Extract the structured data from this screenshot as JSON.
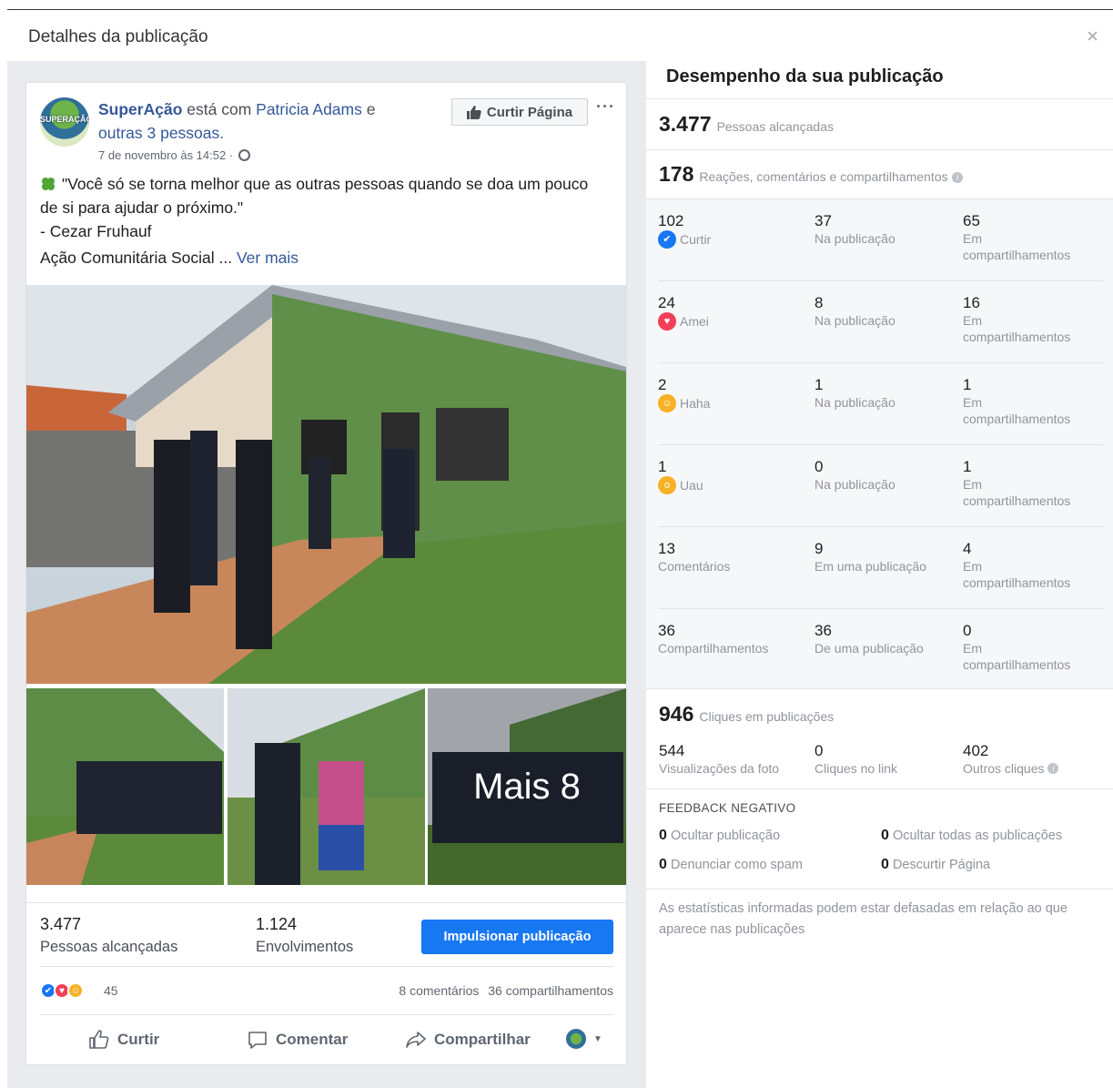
{
  "modal": {
    "title": "Detalhes da publicação",
    "close": "×"
  },
  "post": {
    "page_name": "SuperAção",
    "with_text": "está com",
    "tagged_person": "Patricia Adams",
    "and_text": "e",
    "others": "outras 3 pessoas.",
    "avatar_text": "SUPERAÇÃO",
    "timestamp": "7 de novembro às 14:52 ·",
    "like_page_label": "Curtir Página",
    "text_line1": "\"Você só se torna melhor que as outras pessoas quando se doa um pouco de si para ajudar o próximo.\"",
    "text_line2": "- Cezar Fruhauf",
    "text_more": "Ação Comunitária Social ...",
    "see_more": "Ver mais",
    "more_photos": "Mais 8",
    "reached_num": "3.477",
    "reached_label": "Pessoas alcançadas",
    "engagement_num": "1.124",
    "engagement_label": "Envolvimentos",
    "boost_label": "Impulsionar publicação",
    "reaction_count": "45",
    "comments_text": "8 comentários",
    "shares_text": "36 compartilhamentos",
    "action_like": "Curtir",
    "action_comment": "Comentar",
    "action_share": "Compartilhar"
  },
  "performance": {
    "title": "Desempenho da sua publicação",
    "reached_num": "3.477",
    "reached_label": "Pessoas alcançadas",
    "engagement_num": "178",
    "engagement_label": "Reações, comentários e compartilhamentos",
    "rows": [
      {
        "num": "102",
        "label": "Curtir",
        "icon": "like-icon",
        "mid_num": "37",
        "mid_label": "Na publicação",
        "right_num": "65",
        "right_label": "Em compartilhamentos"
      },
      {
        "num": "24",
        "label": "Amei",
        "icon": "love-icon",
        "mid_num": "8",
        "mid_label": "Na publicação",
        "right_num": "16",
        "right_label": "Em compartilhamentos"
      },
      {
        "num": "2",
        "label": "Haha",
        "icon": "haha-icon",
        "mid_num": "1",
        "mid_label": "Na publicação",
        "right_num": "1",
        "right_label": "Em compartilhamentos"
      },
      {
        "num": "1",
        "label": "Uau",
        "icon": "wow-icon",
        "mid_num": "0",
        "mid_label": "Na publicação",
        "right_num": "1",
        "right_label": "Em compartilhamentos"
      },
      {
        "num": "13",
        "label": "Comentários",
        "mid_num": "9",
        "mid_label": "Em uma publicação",
        "right_num": "4",
        "right_label": "Em compartilhamentos"
      },
      {
        "num": "36",
        "label": "Compartilhamentos",
        "mid_num": "36",
        "mid_label": "De uma publicação",
        "right_num": "0",
        "right_label": "Em compartilhamentos"
      }
    ],
    "clicks_num": "946",
    "clicks_label": "Cliques em publicações",
    "clicks": [
      {
        "num": "544",
        "label": "Visualizações da foto"
      },
      {
        "num": "0",
        "label": "Cliques no link"
      },
      {
        "num": "402",
        "label": "Outros cliques"
      }
    ],
    "negative_title": "FEEDBACK NEGATIVO",
    "negative": [
      {
        "num": "0",
        "label": "Ocultar publicação"
      },
      {
        "num": "0",
        "label": "Ocultar todas as publicações"
      },
      {
        "num": "0",
        "label": "Denunciar como spam"
      },
      {
        "num": "0",
        "label": "Descurtir Página"
      }
    ],
    "note": "As estatísticas informadas podem estar defasadas em relação ao que aparece nas publicações"
  },
  "colors": {
    "accent": "#1877f2",
    "link": "#365899",
    "like": "#1877f2",
    "love": "#f33e58",
    "haha": "#f7b125"
  }
}
